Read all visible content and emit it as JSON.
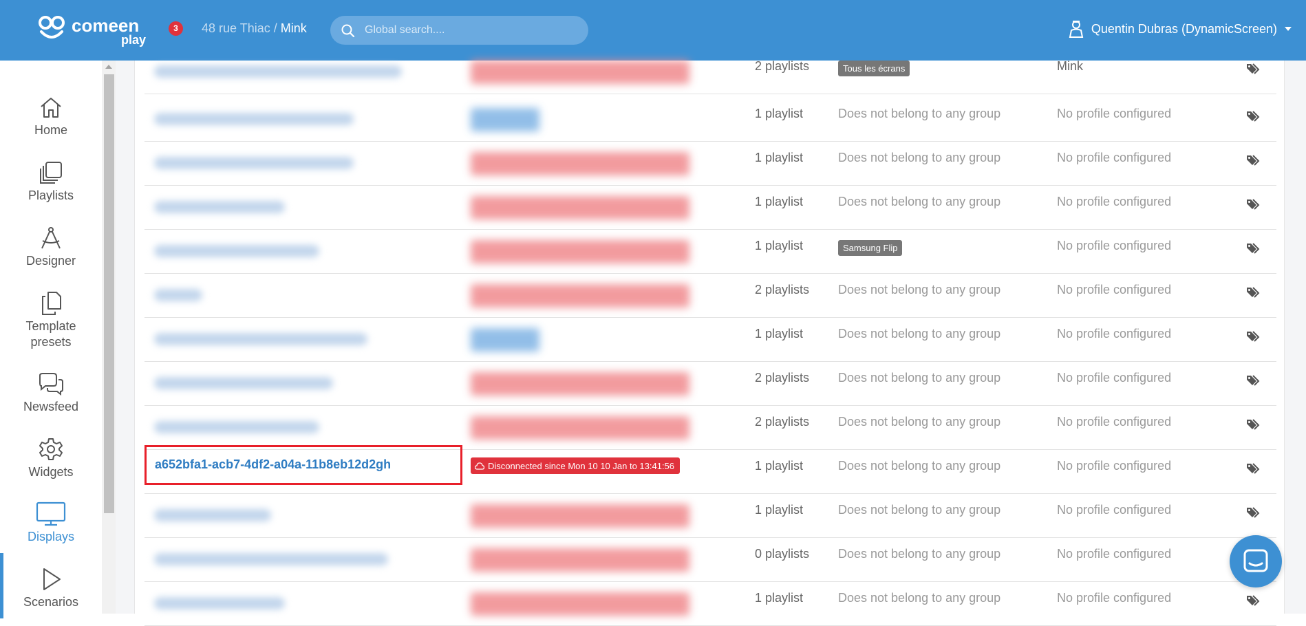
{
  "header": {
    "logo_text": "comeen",
    "logo_sub": "play",
    "notification_count": "3",
    "breadcrumb_location": "48 rue Thiac /",
    "breadcrumb_current": "Mink",
    "search_placeholder": "Global search....",
    "user_name": "Quentin Dubras (DynamicScreen)"
  },
  "sidebar": {
    "items": [
      {
        "label": "Home",
        "icon": "home-icon"
      },
      {
        "label": "Playlists",
        "icon": "playlists-icon"
      },
      {
        "label": "Designer",
        "icon": "compass-icon"
      },
      {
        "label": "Template presets",
        "icon": "copy-icon"
      },
      {
        "label": "Newsfeed",
        "icon": "chat-bubbles-icon"
      },
      {
        "label": "Widgets",
        "icon": "gear-icon"
      },
      {
        "label": "Displays",
        "icon": "monitor-icon",
        "active": true
      },
      {
        "label": "Scenarios",
        "icon": "play-icon"
      }
    ]
  },
  "displays": {
    "rows": [
      {
        "name_blurred": true,
        "status": "red",
        "playlists": "2 playlists",
        "group_badge": "Tous les écrans",
        "group": "",
        "profile": "Mink"
      },
      {
        "name_blurred": true,
        "status": "blue",
        "playlists": "1 playlist",
        "group_badge": "",
        "group": "Does not belong to any group",
        "profile": "No profile configured"
      },
      {
        "name_blurred": true,
        "status": "red",
        "playlists": "1 playlist",
        "group_badge": "",
        "group": "Does not belong to any group",
        "profile": "No profile configured"
      },
      {
        "name_blurred": true,
        "status": "red",
        "playlists": "1 playlist",
        "group_badge": "",
        "group": "Does not belong to any group",
        "profile": "No profile configured"
      },
      {
        "name_blurred": true,
        "status": "red",
        "playlists": "1 playlist",
        "group_badge": "Samsung Flip",
        "group": "",
        "profile": "No profile configured"
      },
      {
        "name_blurred": true,
        "status": "red",
        "playlists": "2 playlists",
        "group_badge": "",
        "group": "Does not belong to any group",
        "profile": "No profile configured"
      },
      {
        "name_blurred": true,
        "status": "blue",
        "playlists": "1 playlist",
        "group_badge": "",
        "group": "Does not belong to any group",
        "profile": "No profile configured"
      },
      {
        "name_blurred": true,
        "status": "red",
        "playlists": "2 playlists",
        "group_badge": "",
        "group": "Does not belong to any group",
        "profile": "No profile configured"
      },
      {
        "name_blurred": true,
        "status": "red",
        "playlists": "2 playlists",
        "group_badge": "",
        "group": "Does not belong to any group",
        "profile": "No profile configured"
      },
      {
        "name_blurred": false,
        "name": "a652bfa1-acb7-4df2-a04a-11b8eb12d2gh",
        "status_text": "Disconnected since Mon 10 10 Jan to 13:41:56",
        "playlists": "1 playlist",
        "group_badge": "",
        "group": "Does not belong to any group",
        "profile": "No profile configured"
      },
      {
        "name_blurred": true,
        "status": "red",
        "playlists": "1 playlist",
        "group_badge": "",
        "group": "Does not belong to any group",
        "profile": "No profile configured"
      },
      {
        "name_blurred": true,
        "status": "red",
        "playlists": "0 playlists",
        "group_badge": "",
        "group": "Does not belong to any group",
        "profile": "No profile configured"
      },
      {
        "name_blurred": true,
        "status": "red",
        "playlists": "1 playlist",
        "group_badge": "",
        "group": "Does not belong to any group",
        "profile": "No profile configured"
      }
    ]
  },
  "colors": {
    "brand": "#3d90d3",
    "danger": "#e0323c",
    "highlight": "#e8202a"
  }
}
